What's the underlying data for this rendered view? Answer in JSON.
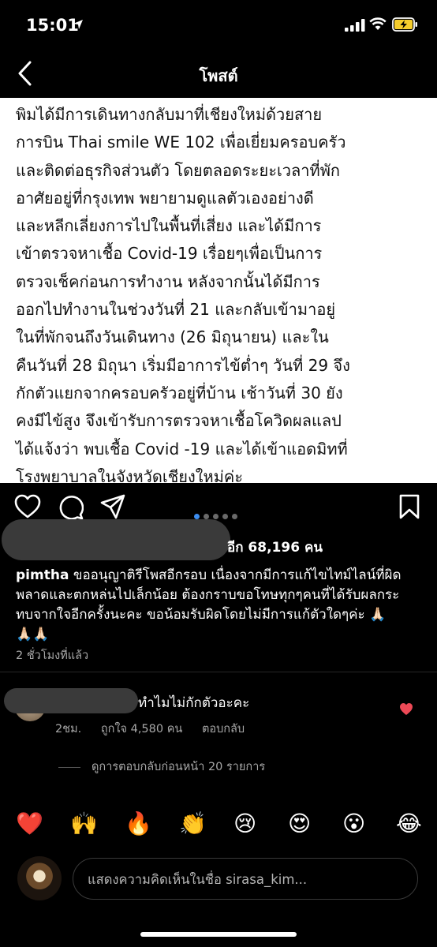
{
  "status_bar": {
    "time": "15:01"
  },
  "nav": {
    "title": "โพสต์"
  },
  "post": {
    "lines": [
      "พิมได้มีการเดินทางกลับมาที่เชียงใหม่ด้วยสาย",
      "การบิน Thai smile WE 102 เพื่อเยี่ยมครอบครัว",
      "และติดต่อธุรกิจส่วนตัว โดยตลอดระยะเวลาที่พัก",
      "อาศัยอยู่ที่กรุงเทพ พยายามดูแลตัวเองอย่างดี",
      "และหลีกเลี่ยงการไปในพื้นที่เสี่ยง และได้มีการ",
      "เข้าตรวจหาเชื้อ Covid-19 เรื่อยๆเพื่อเป็นการ",
      "ตรวจเช็คก่อนการทำงาน หลังจากนั้นได้มีการ",
      "ออกไปทำงานในช่วงวันที่ 21 และกลับเข้ามาอยู่",
      "ในที่พักจนถึงวันเดินทาง (26 มิถุนายน) และใน",
      "คืนวันที่ 28 มิถุนา เริ่มมีอาการไข้ต่ำๆ วันที่ 29 จึง",
      "กักตัวแยกจากครอบครัวอยู่ที่บ้าน เช้าวันที่ 30 ยัง",
      "คงมีไข้สูง จึงเข้ารับการตรวจหาเชื้อโควิดผลแลป",
      "ได้แจ้งว่า พบเชื้อ Covid -19 และได้เข้าแอดมิทที่",
      "โรงพยาบาลในจังหวัดเชียงใหม่ค่ะ"
    ]
  },
  "carousel": {
    "count": 5,
    "active_index": 0,
    "active_color": "#3d8ef0"
  },
  "likes": {
    "text": "อีก 68,196 คน"
  },
  "caption": {
    "username": "pimtha",
    "line1_rest": " ขออนุญาติรีโพสอีกรอบ เนื่องจากมีการแก้ไขไทม์ไลน์ที่ผิด",
    "line2": "พลาดและตกหล่นไปเล็กน้อย ต้องกราบขอโทษทุกๆคนที่ได้รับผลกระ",
    "line3": "ทบจากใจอีกครั้งนะคะ ขอน้อมรับผิดโดยไม่มีการแก้ตัวใดๆค่ะ 🙏🏻",
    "line4": "🙏🏻🙏🏻",
    "time": "2 ชั่วโมงที่แล้ว"
  },
  "comment": {
    "text": "ทำไมไม่กักตัวอะคะ",
    "age": "2ชม.",
    "likes": "ถูกใจ 4,580 คน",
    "reply": "ตอบกลับ",
    "heart_color": "#ed4956"
  },
  "view_replies": "ดูการตอบกลับก่อนหน้า 20 รายการ",
  "emoji_row": [
    "❤️",
    "🙌",
    "🔥",
    "👏",
    "😢",
    "😍",
    "😮",
    "😂"
  ],
  "comment_input": {
    "placeholder": "แสดงความคิดเห็นในชื่อ sirasa_kim..."
  }
}
